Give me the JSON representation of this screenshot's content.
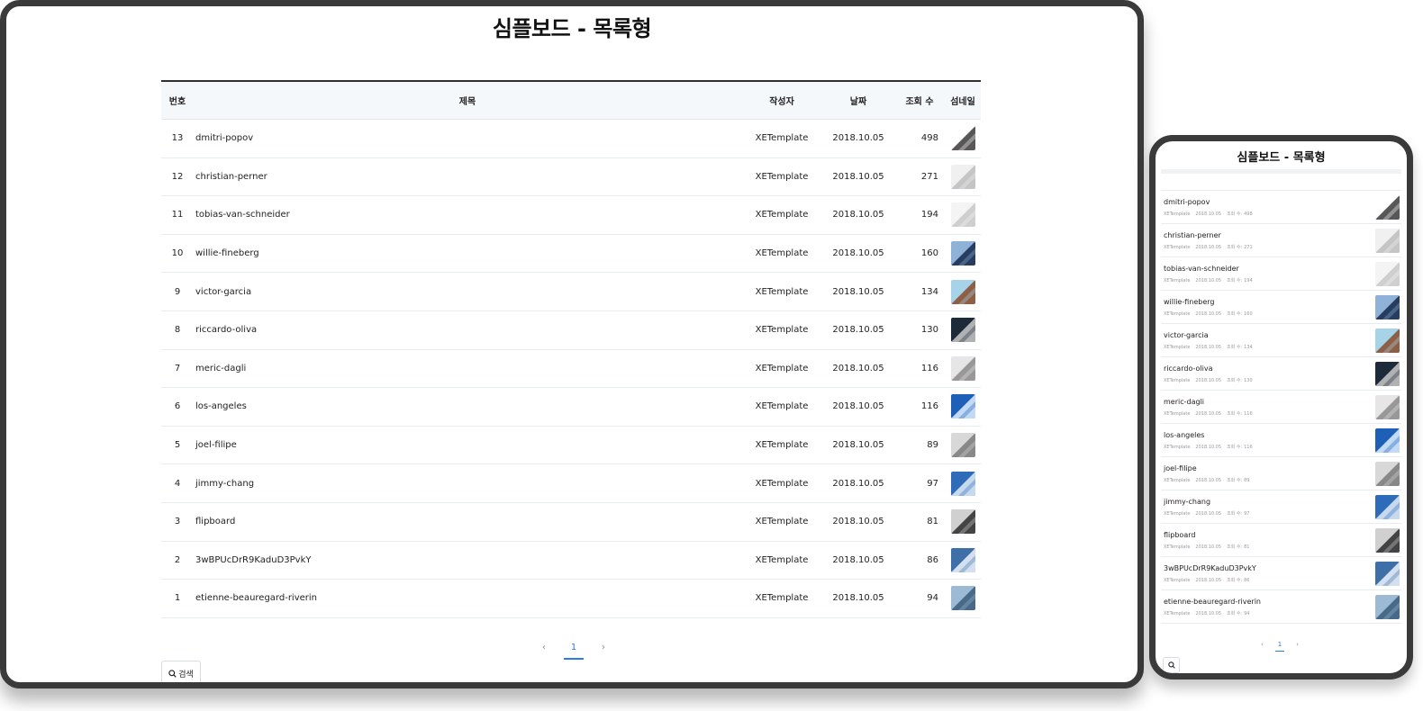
{
  "board": {
    "title": "심플보드 - 목록형",
    "columns": {
      "number": "번호",
      "title": "제목",
      "author": "작성자",
      "date": "날짜",
      "views": "조회 수",
      "thumbnail": "섬네일"
    },
    "views_label": "조회 수:",
    "search_label": "검색",
    "pagination": {
      "prev": "‹",
      "current": "1",
      "next": "›"
    },
    "posts": [
      {
        "number": "13",
        "title": "dmitri-popov",
        "author": "XETemplate",
        "date": "2018.10.05",
        "views": "498",
        "thumb_icon": "diagonal-architecture-thumbnail",
        "colors": [
          "#ffffff",
          "#3a3a3a"
        ]
      },
      {
        "number": "12",
        "title": "christian-perner",
        "author": "XETemplate",
        "date": "2018.10.05",
        "views": "271",
        "thumb_icon": "white-facade-thumbnail",
        "colors": [
          "#f0f0f0",
          "#bdbdbd"
        ]
      },
      {
        "number": "11",
        "title": "tobias-van-schneider",
        "author": "XETemplate",
        "date": "2018.10.05",
        "views": "194",
        "thumb_icon": "white-curve-thumbnail",
        "colors": [
          "#f4f4f4",
          "#c8c8c8"
        ]
      },
      {
        "number": "10",
        "title": "willie-fineberg",
        "author": "XETemplate",
        "date": "2018.10.05",
        "views": "160",
        "thumb_icon": "blue-dome-thumbnail",
        "colors": [
          "#8fb2d8",
          "#14284a"
        ]
      },
      {
        "number": "9",
        "title": "victor-garcia",
        "author": "XETemplate",
        "date": "2018.10.05",
        "views": "134",
        "thumb_icon": "copper-building-thumbnail",
        "colors": [
          "#a7d3e8",
          "#8a4a2a"
        ]
      },
      {
        "number": "8",
        "title": "riccardo-oliva",
        "author": "XETemplate",
        "date": "2018.10.05",
        "views": "130",
        "thumb_icon": "dark-peak-thumbnail",
        "colors": [
          "#1c2a3a",
          "#c9c9c9"
        ]
      },
      {
        "number": "7",
        "title": "meric-dagli",
        "author": "XETemplate",
        "date": "2018.10.05",
        "views": "116",
        "thumb_icon": "grey-panel-thumbnail",
        "colors": [
          "#e6e6e6",
          "#8a8a8a"
        ]
      },
      {
        "number": "6",
        "title": "los-angeles",
        "author": "XETemplate",
        "date": "2018.10.05",
        "views": "116",
        "thumb_icon": "blue-cross-thumbnail",
        "colors": [
          "#1e5fb8",
          "#dff0ff"
        ]
      },
      {
        "number": "5",
        "title": "joel-filipe",
        "author": "XETemplate",
        "date": "2018.10.05",
        "views": "89",
        "thumb_icon": "grid-facade-thumbnail",
        "colors": [
          "#d8d8d8",
          "#7a7a7a"
        ]
      },
      {
        "number": "4",
        "title": "jimmy-chang",
        "author": "XETemplate",
        "date": "2018.10.05",
        "views": "97",
        "thumb_icon": "blue-tower-thumbnail",
        "colors": [
          "#2e6bb8",
          "#e0ecf8"
        ]
      },
      {
        "number": "3",
        "title": "flipboard",
        "author": "XETemplate",
        "date": "2018.10.05",
        "views": "81",
        "thumb_icon": "mono-building-thumbnail",
        "colors": [
          "#d0d0d0",
          "#2a2a2a"
        ]
      },
      {
        "number": "2",
        "title": "3wBPUcDrR9KaduD3PvkY",
        "author": "XETemplate",
        "date": "2018.10.05",
        "views": "86",
        "thumb_icon": "window-cross-thumbnail",
        "colors": [
          "#3e6fa8",
          "#eef4fb"
        ]
      },
      {
        "number": "1",
        "title": "etienne-beauregard-riverin",
        "author": "XETemplate",
        "date": "2018.10.05",
        "views": "94",
        "thumb_icon": "pyramid-thumbnail",
        "colors": [
          "#9cbad4",
          "#3a5a7a"
        ]
      }
    ]
  }
}
